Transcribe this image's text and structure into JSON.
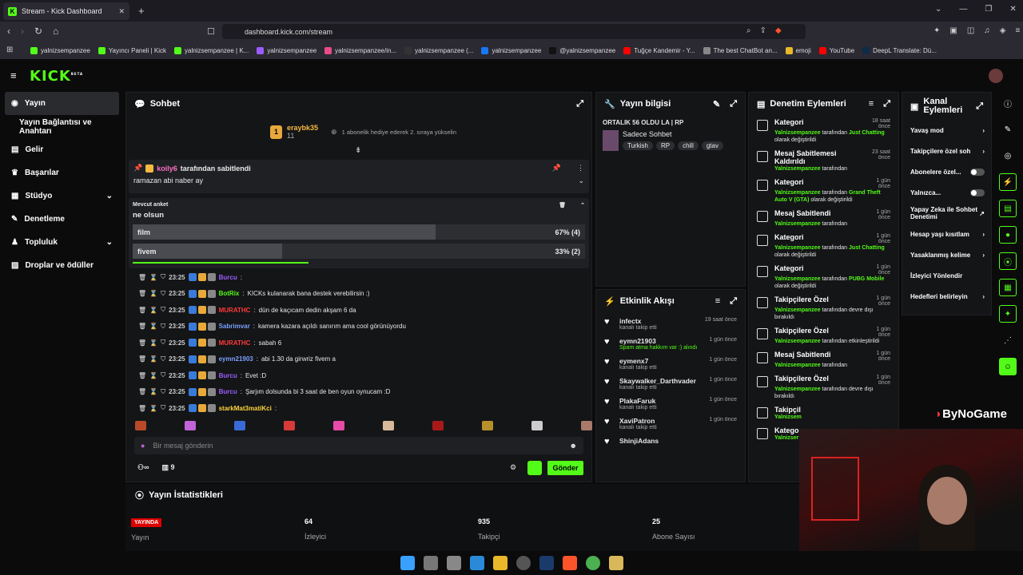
{
  "browser": {
    "tab_title": "Stream - Kick Dashboard",
    "url": "dashboard.kick.com/stream"
  },
  "bookmarks": [
    "yalnizsempanzee",
    "Yayıncı Paneli | Kick",
    "yalnizsempanzee | K...",
    "yalnizsempanzee",
    "yalnizsempanzee/in...",
    "yalnizsempanzee (...",
    "yalnizsempanzee",
    "@yalnizsempanzee",
    "Tuğçe Kandemir - Y...",
    "The best ChatBot an...",
    "emoji",
    "YouTube",
    "DeepL Translate: Dü..."
  ],
  "brand": {
    "logo": "KICK",
    "beta": "BETA"
  },
  "sidebar": {
    "items": [
      "Yayın",
      "Yayın Bağlantısı ve Anahtarı",
      "Gelir",
      "Başarılar",
      "Stüdyo",
      "Denetleme",
      "Topluluk",
      "Droplar ve ödüller"
    ]
  },
  "chat": {
    "title": "Sohbet",
    "gift_user": "eraybk35",
    "gift_num": "11",
    "gift_text": "1 abonelik hediye ederek 2. sıraya yükselin",
    "pinned_by": "koily6",
    "pinned_by_suffix": "tarafından sabitlendi",
    "pinned_msg": "ramazan abi naber ay",
    "poll_label": "Mevcut anket",
    "poll_question": "ne olsun",
    "poll_options": [
      {
        "label": "film",
        "pct": "67% (4)",
        "value": 67
      },
      {
        "label": "fivem",
        "pct": "33% (2)",
        "value": 33
      }
    ],
    "messages": [
      {
        "t": "23:25",
        "u": "Burcu",
        "c": "#9b5cff",
        "m": ""
      },
      {
        "t": "23:25",
        "u": "BotRix",
        "c": "#53fc18",
        "m": "KICKs kulanarak bana destek verebilirsin :)"
      },
      {
        "t": "23:25",
        "u": "MURATHC",
        "c": "#ff3a3a",
        "m": "dün de kaçıcam dedin akşam 6 da"
      },
      {
        "t": "23:25",
        "u": "Sabrimvar",
        "c": "#7aa0ff",
        "m": "kamera kazara açıldı sanırım ama cool görünüyordu"
      },
      {
        "t": "23:25",
        "u": "MURATHC",
        "c": "#ff3a3a",
        "m": "sabah 6"
      },
      {
        "t": "23:25",
        "u": "eymn21903",
        "c": "#7aa0ff",
        "m": "abi 1.30 da girwriz fivem a"
      },
      {
        "t": "23:25",
        "u": "Burcu",
        "c": "#9b5cff",
        "m": "Evet :D"
      },
      {
        "t": "23:25",
        "u": "Burcu",
        "c": "#9b5cff",
        "m": "Şarjım dolsunda bi 3 saat de ben oyun oynucam :D"
      },
      {
        "t": "23:25",
        "u": "starkMat3matiKci",
        "c": "#ffd43a",
        "m": ""
      }
    ],
    "input_placeholder": "Bir mesaj gönderin",
    "viewer_count": "9",
    "send": "Gönder"
  },
  "info": {
    "title": "Yayın bilgisi",
    "stream_title": "ORTALIK 56 OLDU LA | RP",
    "category": "Sadece Sohbet",
    "tags": [
      "Turkish",
      "RP",
      "chill",
      "gtav"
    ]
  },
  "activity": {
    "title": "Etkinlik Akışı",
    "items": [
      {
        "u": "infectx",
        "s": "kanalı takip etti",
        "time": "19 saat önce"
      },
      {
        "u": "eymn21903",
        "s": "Spam atma hakkım var :) alındı",
        "time": "1 gün önce"
      },
      {
        "u": "eymenx7",
        "s": "kanalı takip etti",
        "time": "1 gün önce"
      },
      {
        "u": "Skaywalker_Darthvader",
        "s": "kanalı takip etti",
        "time": "1 gün önce"
      },
      {
        "u": "PlakaFaruk",
        "s": "kanalı takip etti",
        "time": "1 gün önce"
      },
      {
        "u": "XaviPatron",
        "s": "kanalı takip etti",
        "time": "1 gün önce"
      },
      {
        "u": "ShinjiAdans",
        "s": "",
        "time": ""
      }
    ]
  },
  "moderation": {
    "title": "Denetim Eylemleri",
    "items": [
      {
        "a": "Kategori",
        "who": "Yalnizsempanzee",
        "txt": "tarafından",
        "x": "Just Chatting",
        "tail": "olarak değiştirildi",
        "time": "18 saat önce"
      },
      {
        "a": "Mesaj Sabitlemesi Kaldırıldı",
        "who": "Yalnizsempanzee",
        "txt": "tarafından",
        "x": "",
        "tail": "",
        "time": "23 saat önce"
      },
      {
        "a": "Kategori",
        "who": "Yalnizsempanzee",
        "txt": "tarafından",
        "x": "Grand Theft Auto V (GTA)",
        "tail": "olarak değiştirildi",
        "time": "1 gün önce"
      },
      {
        "a": "Mesaj Sabitlendi",
        "who": "Yalnizsempanzee",
        "txt": "tarafından",
        "x": "",
        "tail": "",
        "time": "1 gün önce"
      },
      {
        "a": "Kategori",
        "who": "Yalnizsempanzee",
        "txt": "tarafından",
        "x": "Just Chatting",
        "tail": "olarak değiştirildi",
        "time": "1 gün önce"
      },
      {
        "a": "Kategori",
        "who": "Yalnizsempanzee",
        "txt": "tarafından",
        "x": "PUBG Mobile",
        "tail": "olarak değiştirildi",
        "time": "1 gün önce"
      },
      {
        "a": "Takipçilere Özel",
        "who": "Yalnizsempanzee",
        "txt": "tarafından devre dışı bırakıldı",
        "x": "",
        "tail": "",
        "time": "1 gün önce"
      },
      {
        "a": "Takipçilere Özel",
        "who": "Yalnizsempanzee",
        "txt": "tarafından etkinleştirildi",
        "x": "",
        "tail": "",
        "time": "1 gün önce"
      },
      {
        "a": "Mesaj Sabitlendi",
        "who": "Yalnizsempanzee",
        "txt": "tarafından",
        "x": "",
        "tail": "",
        "time": "1 gün önce"
      },
      {
        "a": "Takipçilere Özel",
        "who": "Yalnizsempanzee",
        "txt": "tarafından devre dışı bırakıldı",
        "x": "",
        "tail": "",
        "time": "1 gün önce"
      },
      {
        "a": "Takipçil",
        "who": "Yalnizsem",
        "txt": "",
        "x": "",
        "tail": "",
        "time": ""
      },
      {
        "a": "Kategor",
        "who": "Yalnizser",
        "txt": "",
        "x": "",
        "tail": "",
        "time": ""
      }
    ]
  },
  "channel_actions": {
    "title": "Kanal Eylemleri",
    "items": [
      "Yavaş mod",
      "Takipçilere özel soh",
      "Abonelere özel...",
      "Yalnızca...",
      "Yapay Zeka ile Sohbet Denetimi",
      "Hesap yaşı kısıtlam",
      "Yasaklanmış kelime",
      "İzleyici Yönlendir",
      "Hedefleri belirleyin"
    ]
  },
  "stats": {
    "title": "Yayın İstatistikleri",
    "live": "YAYINDA",
    "live_label": "Yayın",
    "viewers": "64",
    "viewers_label": "İzleyici",
    "followers": "935",
    "followers_label": "Takipçi",
    "subs": "25",
    "subs_label": "Abone Sayısı"
  },
  "watermark": "ByNoGame"
}
